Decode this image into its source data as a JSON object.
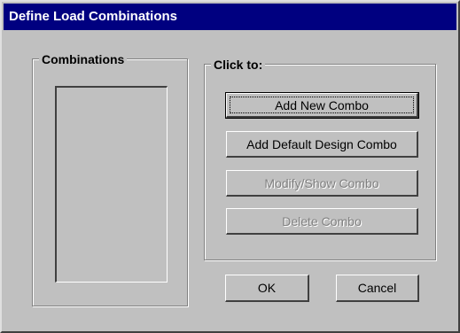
{
  "window": {
    "title": "Define Load Combinations"
  },
  "combinations": {
    "label": "Combinations",
    "items": []
  },
  "actions": {
    "label": "Click to:",
    "add_new": "Add New Combo",
    "add_default": "Add Default Design Combo",
    "modify_show": "Modify/Show Combo",
    "delete": "Delete Combo"
  },
  "footer": {
    "ok": "OK",
    "cancel": "Cancel"
  }
}
